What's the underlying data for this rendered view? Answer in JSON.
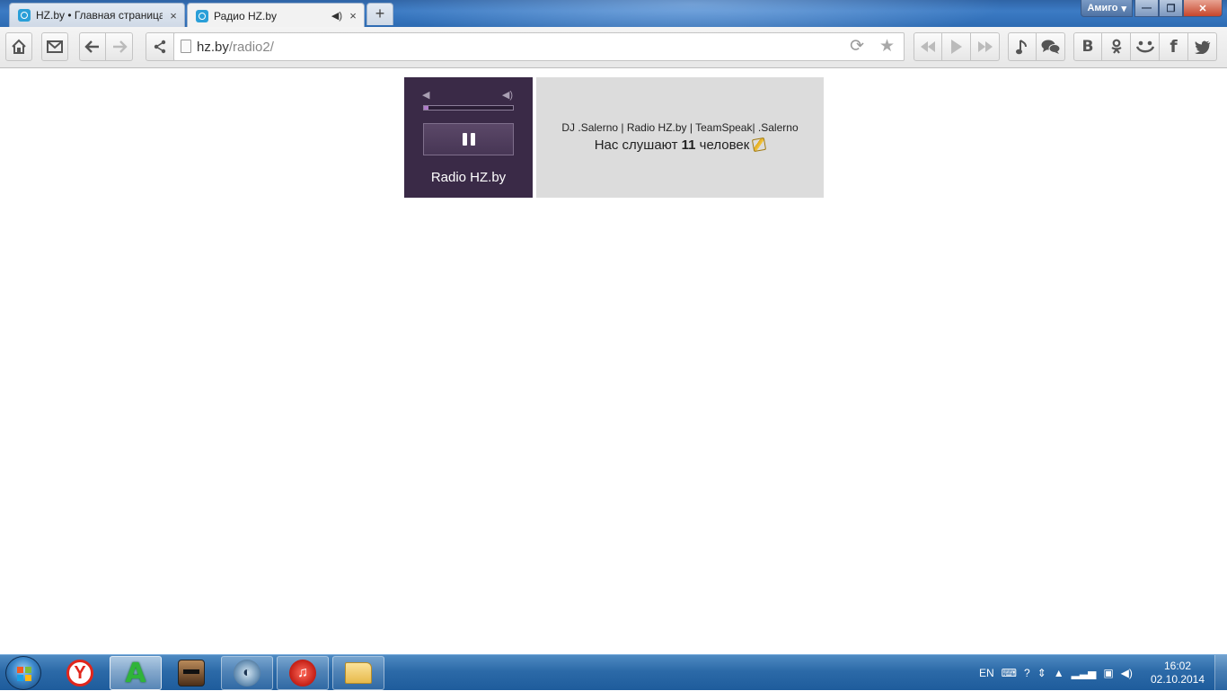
{
  "browser": {
    "tabs": [
      {
        "label": "HZ.by • Главная страница",
        "close": "×"
      },
      {
        "label": "Радио HZ.by",
        "close": "×",
        "sound": "◀)"
      }
    ],
    "new_tab": "+",
    "profile": "Амиго",
    "window_controls": {
      "minimize": "—",
      "maximize": "❐",
      "close": "✕"
    },
    "url": {
      "host": "hz.by",
      "path": "/radio2/"
    },
    "toolbar_icons": [
      "home-icon",
      "mail-icon",
      "back-icon",
      "forward-icon",
      "share-icon",
      "reload-icon",
      "star-icon",
      "previous-icon",
      "play-icon",
      "next-icon",
      "music-icon",
      "chat-icon",
      "vk-icon",
      "odnoklassniki-icon",
      "moi-mir-icon",
      "facebook-icon",
      "twitter-icon"
    ],
    "vk_label": "B",
    "fb_label": "f"
  },
  "player": {
    "station": "Radio HZ.by",
    "volume": 0.05,
    "state": "playing",
    "accent": "#3a2a47"
  },
  "info": {
    "track": "DJ .Salerno | Radio HZ.by | TeamSpeak| .Salerno",
    "listeners_prefix": "Нас слушают",
    "listeners_count": "11",
    "listeners_suffix": "человек"
  },
  "taskbar": {
    "apps": [
      "yandex-browser-icon",
      "amigo-icon",
      "game-icon",
      "teamspeak-icon",
      "music-player-icon",
      "explorer-icon"
    ],
    "amigo_letter": "A",
    "yandex_letter": "Y",
    "language": "EN",
    "time": "16:02",
    "date": "02.10.2014"
  }
}
